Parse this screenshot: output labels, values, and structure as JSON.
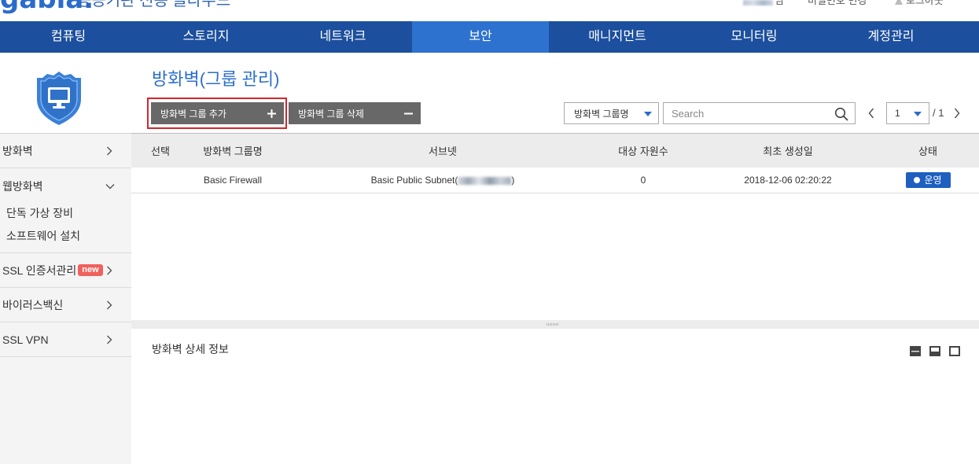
{
  "header": {
    "logo": "gabia.",
    "service_name": "공공기관 전용 클라우드",
    "user_suffix": "님",
    "change_password": "비밀번호 변경",
    "logout": "로그아웃",
    "logout_icon": "logout-icon"
  },
  "nav": {
    "items": [
      {
        "label": "컴퓨팅",
        "active": false
      },
      {
        "label": "스토리지",
        "active": false
      },
      {
        "label": "네트워크",
        "active": false
      },
      {
        "label": "보안",
        "active": true
      },
      {
        "label": "매니지먼트",
        "active": false
      },
      {
        "label": "모니터링",
        "active": false
      },
      {
        "label": "계정관리",
        "active": false
      }
    ]
  },
  "sidebar": {
    "logo_icon": "shield-monitor-icon",
    "items": [
      {
        "label": "방화벽",
        "icon": "chevron-right-icon"
      },
      {
        "label": "웹방화벽",
        "icon": "chevron-down-icon",
        "expanded": true,
        "children": [
          {
            "label": "단독 가상 장비"
          },
          {
            "label": "소프트웨어 설치"
          }
        ]
      },
      {
        "label": "SSL 인증서관리",
        "badge": "new",
        "icon": "chevron-right-icon"
      },
      {
        "label": "바이러스백신",
        "icon": "chevron-right-icon"
      },
      {
        "label": "SSL VPN",
        "icon": "chevron-right-icon"
      }
    ]
  },
  "page": {
    "title": "방화벽(그룹 관리)"
  },
  "toolbar": {
    "add_button": {
      "label": "방화벽 그룹 추가",
      "icon": "plus-icon",
      "highlighted": true
    },
    "delete_button": {
      "label": "방화벽 그룹 삭제",
      "icon": "minus-icon"
    },
    "search_field_select": {
      "selected": "방화벽 그룹명",
      "icon": "caret-down-icon"
    },
    "search": {
      "placeholder": "Search",
      "icon": "search-icon"
    },
    "pagination": {
      "current_page": "1",
      "total_label": "/ 1",
      "prev_icon": "chevron-left-icon",
      "next_icon": "chevron-right-icon"
    }
  },
  "table": {
    "columns": [
      "선택",
      "방화벽 그룹명",
      "서브넷",
      "대상 자원수",
      "최초 생성일",
      "상태"
    ],
    "rows": [
      {
        "group_name": "Basic Firewall",
        "subnet_prefix": "Basic Public Subnet(",
        "subnet_suffix": ")",
        "resource_count": "0",
        "created": "2018-12-06 02:20:22",
        "status": "운영"
      }
    ]
  },
  "detail": {
    "title": "방화벽 상세 정보",
    "layout_icons": [
      "layout-collapse-icon",
      "layout-split-icon",
      "layout-expand-icon"
    ]
  },
  "colors": {
    "brand": "#2a6ccb",
    "nav_bg": "#1c4f9d",
    "nav_active": "#2d72cf",
    "title": "#2c6fca",
    "button_bg": "#686868",
    "highlight_border": "#d4262b",
    "status_badge": "#1e5fc0",
    "new_badge": "#f0605c",
    "sidebar_bg": "#f4f4f4"
  }
}
